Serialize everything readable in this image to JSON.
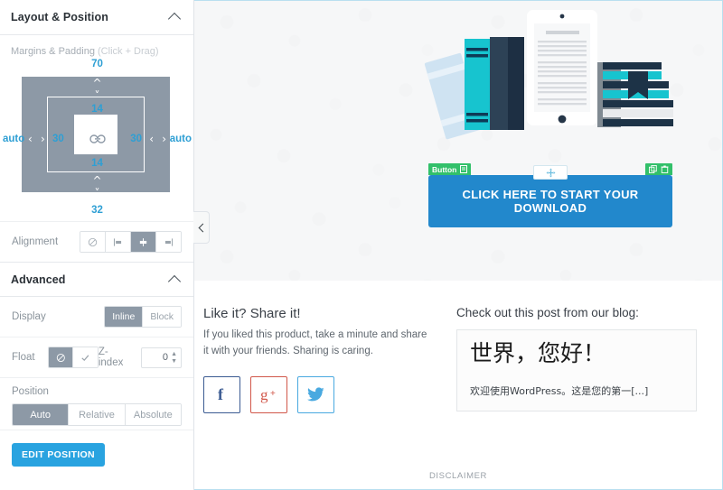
{
  "sidebar": {
    "panels": [
      {
        "title": "Layout & Position",
        "collapse_icon": "chevron-up-icon",
        "margins": {
          "label": "Margins & Padding",
          "hint": "(Click + Drag)",
          "margin_top": "70",
          "margin_bottom": "32",
          "margin_left": "auto",
          "margin_right": "auto",
          "padding_top": "14",
          "padding_bottom": "14",
          "padding_left": "30",
          "padding_right": "30",
          "link_icon": "link-icon"
        },
        "alignment": {
          "label": "Alignment",
          "options": [
            {
              "name": "none",
              "icon": "no-entry-icon",
              "selected": false
            },
            {
              "name": "left",
              "icon": "align-left-icon",
              "selected": false
            },
            {
              "name": "center",
              "icon": "align-center-icon",
              "selected": true
            },
            {
              "name": "right",
              "icon": "align-right-icon",
              "selected": false
            }
          ]
        }
      },
      {
        "title": "Advanced",
        "collapse_icon": "chevron-up-icon",
        "display": {
          "label": "Display",
          "options": [
            {
              "label": "Inline",
              "selected": true
            },
            {
              "label": "Block",
              "selected": false
            }
          ]
        },
        "float": {
          "label": "Float",
          "options": [
            {
              "name": "none",
              "icon": "no-entry-icon",
              "selected": true
            },
            {
              "name": "on",
              "icon": "check-icon",
              "selected": false
            }
          ]
        },
        "zindex": {
          "label": "Z-index",
          "value": "0"
        },
        "position": {
          "label": "Position",
          "options": [
            {
              "label": "Auto",
              "selected": true
            },
            {
              "label": "Relative",
              "selected": false
            },
            {
              "label": "Absolute",
              "selected": false
            }
          ]
        },
        "edit_position_button": "EDIT POSITION"
      }
    ],
    "collapse_handle_icon": "chevron-left-icon"
  },
  "preview": {
    "illustration": "books-and-tablet-illustration",
    "button_module": {
      "tag_label": "Button",
      "tag_icon": "module-icon",
      "drag_icon": "move-arrows-icon",
      "action_icons": [
        "duplicate-icon",
        "trash-icon"
      ],
      "cta_label": "CLICK HERE TO START YOUR DOWNLOAD"
    },
    "share": {
      "heading": "Like it? Share it!",
      "body": "If you liked this product, take a minute and share it with your friends. Sharing is caring.",
      "socials": [
        {
          "name": "facebook",
          "glyph": "f",
          "color": "#3b5b92"
        },
        {
          "name": "google-plus",
          "glyph": "g+",
          "color": "#d1574a"
        },
        {
          "name": "twitter",
          "glyph": "bird",
          "color": "#49a9e0"
        }
      ]
    },
    "blog": {
      "heading": "Check out this post from our blog:",
      "post_title": "世界，您好！",
      "post_excerpt": "欢迎使用WordPress。这是您的第一[...]"
    },
    "disclaimer": "DISCLAIMER"
  },
  "colors": {
    "accent_blue": "#29a3e0",
    "cta_blue": "#2288cc",
    "module_green": "#32c06a",
    "control_gray": "#8d99a6",
    "value_blue": "#2e9fd4"
  }
}
